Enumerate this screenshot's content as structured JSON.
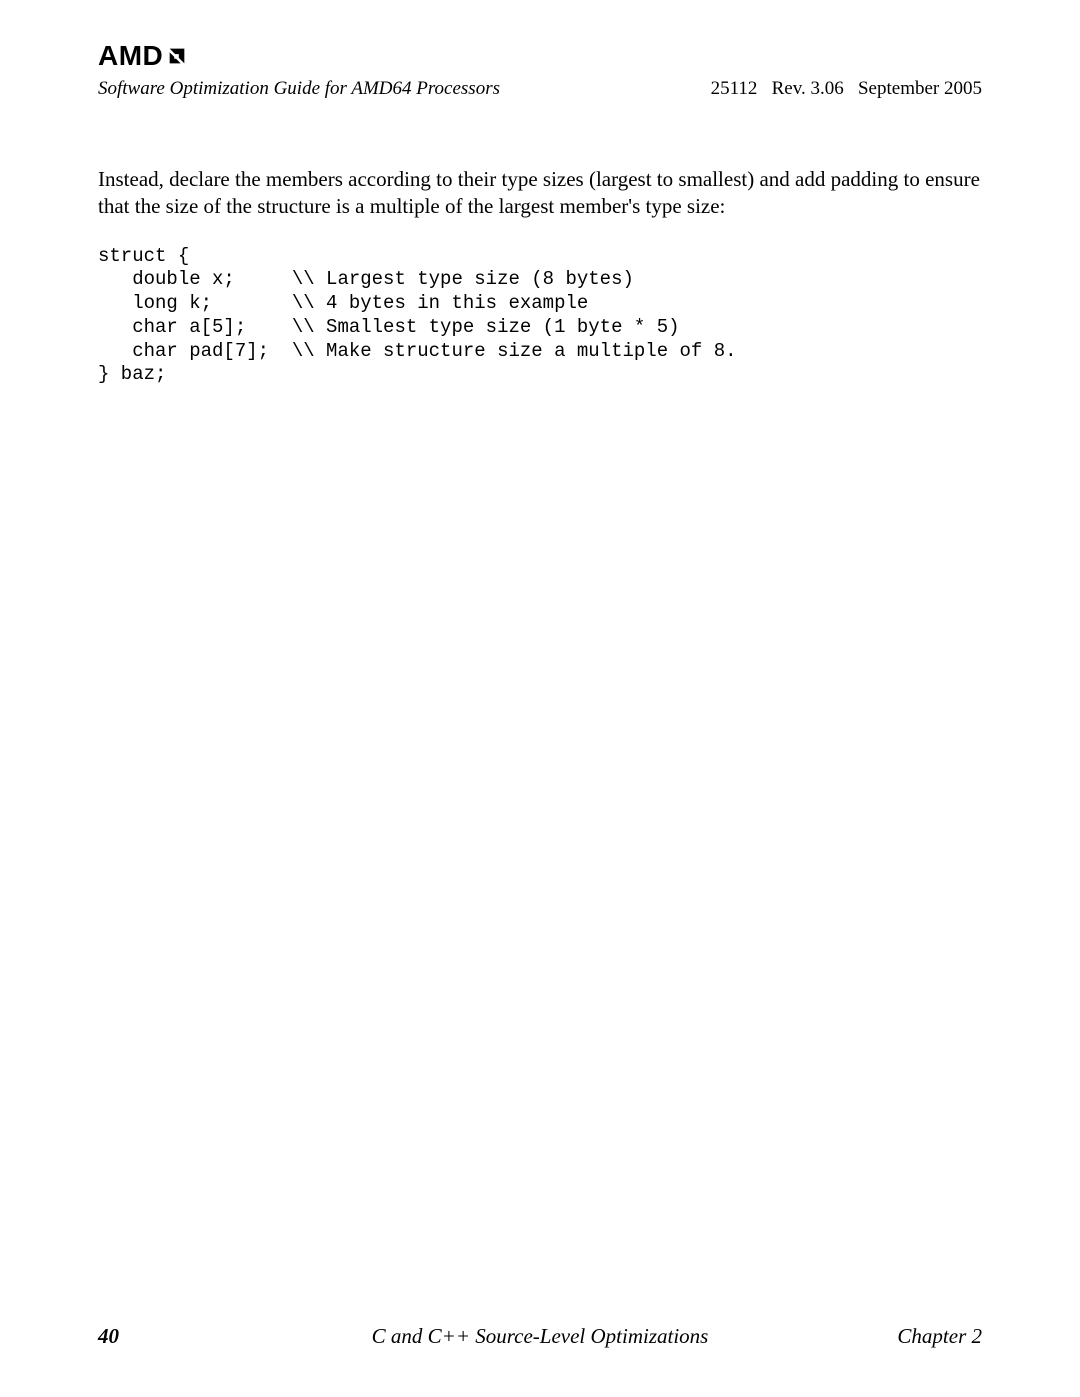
{
  "header": {
    "logo_text": "AMD",
    "doc_title": "Software Optimization Guide for AMD64 Processors",
    "doc_meta": "25112   Rev. 3.06   September 2005"
  },
  "body": {
    "paragraph": "Instead, declare the members according to their type sizes (largest to smallest) and add padding to ensure that the size of the structure is a multiple of the largest member's type size:",
    "code": "struct {\n   double x;     \\\\ Largest type size (8 bytes)\n   long k;       \\\\ 4 bytes in this example\n   char a[5];    \\\\ Smallest type size (1 byte * 5)\n   char pad[7];  \\\\ Make structure size a multiple of 8.\n} baz;"
  },
  "footer": {
    "page_number": "40",
    "center_title": "C and C++ Source-Level Optimizations",
    "chapter": "Chapter 2"
  }
}
